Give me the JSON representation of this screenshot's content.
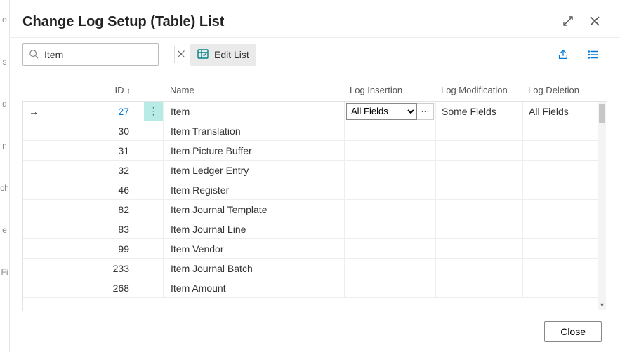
{
  "edge_labels": [
    "o",
    "s",
    "d",
    "n",
    "ch",
    "e",
    "Fi"
  ],
  "header": {
    "title": "Change Log Setup (Table) List"
  },
  "toolbar": {
    "search_value": "Item",
    "edit_list_label": "Edit List"
  },
  "columns": {
    "id": "ID",
    "id_sort": "↑",
    "name": "Name",
    "log_insertion": "Log Insertion",
    "log_modification": "Log Modification",
    "log_deletion": "Log Deletion"
  },
  "log_insertion_options": [
    "",
    "All Fields",
    "Some Fields"
  ],
  "rows": [
    {
      "id": "27",
      "name": "Item",
      "selected": true,
      "log_insertion": "All Fields",
      "log_modification": "Some Fields",
      "log_deletion": "All Fields"
    },
    {
      "id": "30",
      "name": "Item Translation",
      "selected": false,
      "log_insertion": "",
      "log_modification": "",
      "log_deletion": ""
    },
    {
      "id": "31",
      "name": "Item Picture Buffer",
      "selected": false,
      "log_insertion": "",
      "log_modification": "",
      "log_deletion": ""
    },
    {
      "id": "32",
      "name": "Item Ledger Entry",
      "selected": false,
      "log_insertion": "",
      "log_modification": "",
      "log_deletion": ""
    },
    {
      "id": "46",
      "name": "Item Register",
      "selected": false,
      "log_insertion": "",
      "log_modification": "",
      "log_deletion": ""
    },
    {
      "id": "82",
      "name": "Item Journal Template",
      "selected": false,
      "log_insertion": "",
      "log_modification": "",
      "log_deletion": ""
    },
    {
      "id": "83",
      "name": "Item Journal Line",
      "selected": false,
      "log_insertion": "",
      "log_modification": "",
      "log_deletion": ""
    },
    {
      "id": "99",
      "name": "Item Vendor",
      "selected": false,
      "log_insertion": "",
      "log_modification": "",
      "log_deletion": ""
    },
    {
      "id": "233",
      "name": "Item Journal Batch",
      "selected": false,
      "log_insertion": "",
      "log_modification": "",
      "log_deletion": ""
    },
    {
      "id": "268",
      "name": "Item Amount",
      "selected": false,
      "log_insertion": "",
      "log_modification": "",
      "log_deletion": ""
    }
  ],
  "footer": {
    "close_label": "Close"
  }
}
